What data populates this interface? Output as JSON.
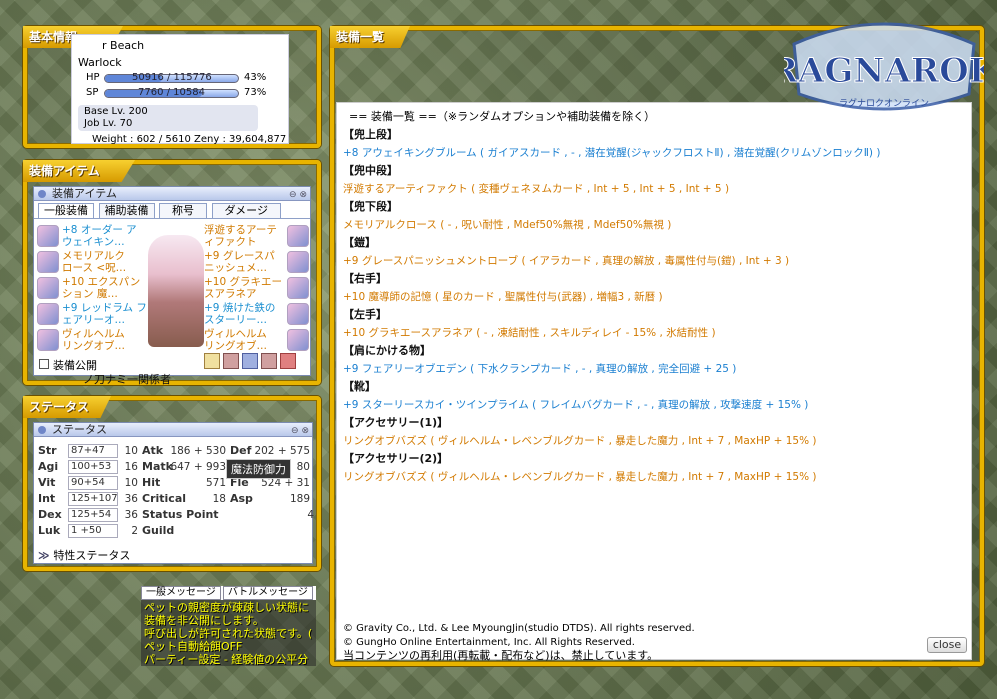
{
  "basic": {
    "frame_title": "基本情報",
    "map_name": "r Beach",
    "job": "Warlock",
    "hp_label": "HP",
    "hp_value": "50916 / 115776",
    "hp_percent": "43%",
    "hp_ratio": 0.43,
    "sp_label": "SP",
    "sp_value": "7760 / 10584",
    "sp_percent": "73%",
    "sp_ratio": 0.73,
    "base_lv": "Base Lv. 200",
    "job_lv": "Job Lv. 70",
    "weight_zeny": "Weight : 602 / 5610  Zeny : 39,604,877"
  },
  "equip_item": {
    "frame_title": "装備アイテム",
    "window_title": "装備アイテム",
    "tabs": [
      "一般装備",
      "補助装備",
      "称号",
      "ダメージ"
    ],
    "left_items": [
      {
        "text": "+8 オーダー ア\nウェイキン…",
        "color": "blue"
      },
      {
        "text": "メモリアルク\nロース <呪…",
        "color": "orange"
      },
      {
        "text": "+10 エクスパン\nション 魔…",
        "color": "orange"
      },
      {
        "text": "+9 レッドラム フ\nェアリーオ…",
        "color": "blue"
      },
      {
        "text": "ヴィルヘルム\nリングオブ…",
        "color": "orange"
      }
    ],
    "right_items": [
      {
        "text": "浮遊するアーテ\nィファクト",
        "color": "orange"
      },
      {
        "text": "+9 グレースパ\nニッシュメ…",
        "color": "orange"
      },
      {
        "text": "+10 グラキエー\nスアラネア",
        "color": "orange"
      },
      {
        "text": "+9 焼けた鉄の\nスターリー…",
        "color": "blue"
      },
      {
        "text": "ヴィルヘルム\nリングオブ…",
        "color": "orange"
      }
    ],
    "public_label": "装備公開",
    "below_text": "ノ刀ナミ一関係者"
  },
  "status": {
    "frame_title": "ステータス",
    "window_title": "ステータス",
    "stats": [
      {
        "label": "Str",
        "value": "87+47",
        "pts": "10"
      },
      {
        "label": "Agi",
        "value": "100+53",
        "pts": "16"
      },
      {
        "label": "Vit",
        "value": "90+54",
        "pts": "10"
      },
      {
        "label": "Int",
        "value": "125+107",
        "pts": "36"
      },
      {
        "label": "Dex",
        "value": "125+54",
        "pts": "36"
      },
      {
        "label": "Luk",
        "value": "1 +50",
        "pts": "2"
      }
    ],
    "sub": [
      {
        "label": "Atk",
        "value": "186 + 530"
      },
      {
        "label": "Matk",
        "value": "647 + 993"
      },
      {
        "label": "Hit",
        "value": "571"
      },
      {
        "label": "Critical",
        "value": "18"
      },
      {
        "label": "Status Point",
        "value": "4"
      },
      {
        "label": "Guild",
        "value": ""
      }
    ],
    "sub2": [
      {
        "label": "Def",
        "value": "202 + 575"
      },
      {
        "label": "",
        "value": "80"
      },
      {
        "label": "Fle",
        "value": "524 + 31"
      },
      {
        "label": "Asp",
        "value": "189"
      }
    ],
    "tooltip": "魔法防御力",
    "traits": "特性ステータス"
  },
  "chat": {
    "tabs": [
      "一般メッセージ",
      "バトルメッセージ"
    ],
    "lines": [
      "ペットの親密度が疎疎しい状態に",
      "装備を非公開にします。",
      "呼び出しが許可された状態です。(",
      "ペット自動給餌OFF",
      "パーティー設定 - 経験値の公平分"
    ]
  },
  "main": {
    "frame_title": "装備一覧",
    "header": "== 装備一覧 ==（※ランダムオプションや補助装備を除く）",
    "sections": [
      {
        "title": "【兜上段】",
        "item": "+8 アウェイキングブルーム ( ガイアスカード , - , 潜在覚醒(ジャックフロストⅡ) , 潜在覚醒(クリムゾンロックⅡ) )",
        "color": "blue"
      },
      {
        "title": "【兜中段】",
        "item": "浮遊するアーティファクト ( 変種ヴェネヌムカード , Int + 5 , Int + 5 , Int + 5 )",
        "color": "orange"
      },
      {
        "title": "【兜下段】",
        "item": "メモリアルクロース ( - , 呪い耐性 , Mdef50%無視 , Mdef50%無視 )",
        "color": "orange"
      },
      {
        "title": "【鎧】",
        "item": "+9 グレースパニッシュメントローブ ( イアラカード , 真理の解放 , 毒属性付与(鎧) , Int + 3 )",
        "color": "orange"
      },
      {
        "title": "【右手】",
        "item": "+10 魔導師の記憶 ( 星のカード , 聖属性付与(武器) , 増幅3 , 新暦 )",
        "color": "orange"
      },
      {
        "title": "【左手】",
        "item": "+10 グラキエースアラネア ( - , 凍結耐性 , スキルディレイ - 15% , 氷結耐性 )",
        "color": "orange"
      },
      {
        "title": "【肩にかける物】",
        "item": "+9 フェアリーオブエデン ( 下水クランプカード , - , 真理の解放 , 完全回避 + 25 )",
        "color": "blue"
      },
      {
        "title": "【靴】",
        "item": "+9 スターリースカイ・ツインプライム ( フレイムバグカード , - , 真理の解放 , 攻撃速度 + 15% )",
        "color": "blue"
      },
      {
        "title": "【アクセサリー(1)】",
        "item": "リングオブバズズ ( ヴィルヘルム・レベンブルグカード , 暴走した魔力 , Int + 7 , MaxHP + 15% )",
        "color": "orange"
      },
      {
        "title": "【アクセサリー(2)】",
        "item": "リングオブバズズ ( ヴィルヘルム・レベンブルグカード , 暴走した魔力 , Int + 7 , MaxHP + 15% )",
        "color": "orange"
      }
    ],
    "copyright1": "© Gravity Co., Ltd. & Lee MyoungJin(studio DTDS). All rights reserved.",
    "copyright2": "© GungHo Online Entertainment, Inc. All Rights Reserved.",
    "notice": "当コンテンツの再利用(再転載・配布など)は、禁止しています。",
    "close_label": "close"
  },
  "logo": {
    "text": "RAGNAROK",
    "sub": "ラグナロクオンライン"
  }
}
